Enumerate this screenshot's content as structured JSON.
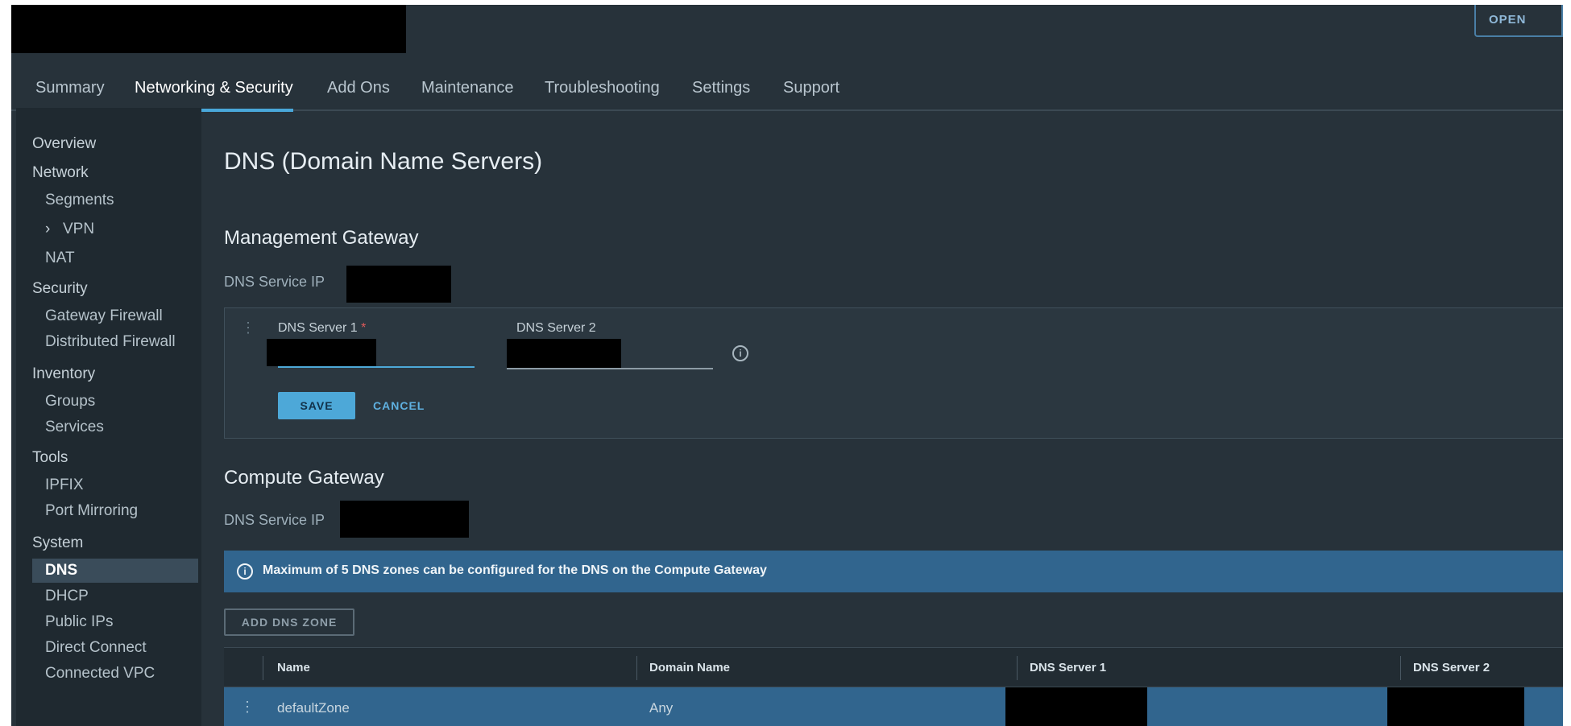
{
  "header": {
    "open_button_label": "OPEN"
  },
  "tabs": [
    {
      "label": "Summary"
    },
    {
      "label": "Networking & Security"
    },
    {
      "label": "Add Ons"
    },
    {
      "label": "Maintenance"
    },
    {
      "label": "Troubleshooting"
    },
    {
      "label": "Settings"
    },
    {
      "label": "Support"
    }
  ],
  "active_tab": "Networking & Security",
  "sidebar": {
    "overview": "Overview",
    "network": {
      "label": "Network",
      "items": [
        "Segments",
        "VPN",
        "NAT"
      ]
    },
    "security": {
      "label": "Security",
      "items": [
        "Gateway Firewall",
        "Distributed Firewall"
      ]
    },
    "inventory": {
      "label": "Inventory",
      "items": [
        "Groups",
        "Services"
      ]
    },
    "tools": {
      "label": "Tools",
      "items": [
        "IPFIX",
        "Port Mirroring"
      ]
    },
    "system": {
      "label": "System",
      "items": [
        "DNS",
        "DHCP",
        "Public IPs",
        "Direct Connect",
        "Connected VPC"
      ]
    },
    "active_item": "DNS"
  },
  "main": {
    "title": "DNS (Domain Name Servers)",
    "management_gateway": {
      "heading": "Management Gateway",
      "dns_service_ip_label": "DNS Service IP",
      "server1_label": "DNS Server 1",
      "required_marker": "*",
      "server2_label": "DNS Server 2",
      "save_label": "SAVE",
      "cancel_label": "CANCEL"
    },
    "compute_gateway": {
      "heading": "Compute Gateway",
      "dns_service_ip_label": "DNS Service IP",
      "banner_text": "Maximum of 5 DNS zones can be configured for the DNS on the Compute Gateway",
      "add_zone_label": "ADD DNS ZONE",
      "columns": [
        "Name",
        "Domain Name",
        "DNS Server 1",
        "DNS Server 2"
      ],
      "rows": [
        {
          "name": "defaultZone",
          "domain": "Any"
        }
      ]
    }
  },
  "colors": {
    "background": "#27323a",
    "sidebar": "#1f2930",
    "accent": "#49a7d9",
    "banner": "#31658e"
  }
}
